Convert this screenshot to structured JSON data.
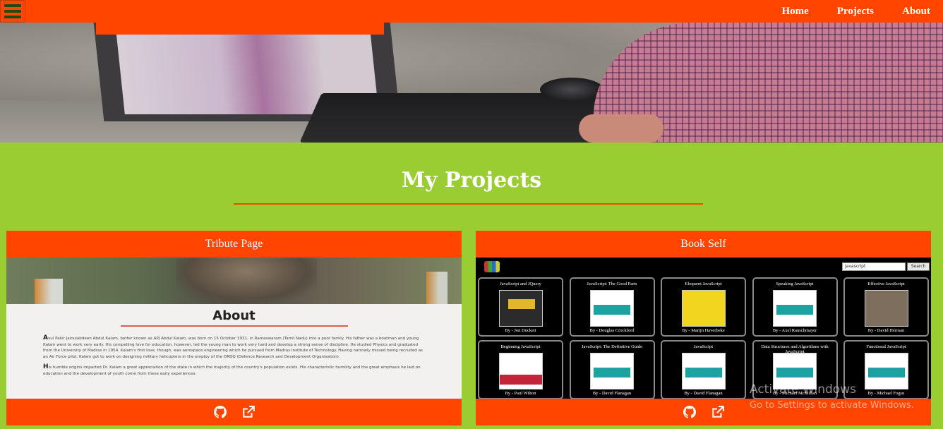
{
  "navbar": {
    "menu_icon": "hamburger-icon",
    "links": [
      "Home",
      "Projects",
      "About"
    ]
  },
  "section": {
    "title": "My Projects"
  },
  "projects": [
    {
      "title": "Tribute Page",
      "preview": {
        "heading": "About",
        "para1_cap": "A",
        "para1": "vul Pakir Jainulabdeen Abdul Kalam, better known as APJ Abdul Kalam, was born on 15 October 1931, in Rameswaram (Tamil Nadu) into a poor family. His father was a boatman and young Kalam went to work very early. His compelling love for education, however, led the young man to work very hard and develop a strong sense of discipline. He studied Physics and graduated from the University of Madras in 1954. Kalam's first love, though, was aerospace engineering which he pursued from Madras Institute of Technology. Having narrowly missed being recruited as an Air Force pilot, Kalam got to work on designing military helicopters in the employ of the DRDO (Defence Research and Development Organisation).",
        "para2_cap": "H",
        "para2": "is humble origins imparted Dr. Kalam a great appreciation of the state in which the majority of the country's population exists. His characteristic humility and the great emphasis he laid on education and the development of youth come from these early experiences."
      },
      "footer_icons": [
        "github-icon",
        "external-link-icon"
      ]
    },
    {
      "title": "Book Self",
      "preview": {
        "search_value": "javascript",
        "search_button": "Search",
        "books": [
          {
            "title": "JavaScript and JQuery",
            "author": "By - Jon Duckett",
            "cover": "dark"
          },
          {
            "title": "JavaScript: The Good Parts",
            "author": "By - Douglas Crockford",
            "cover": "teal"
          },
          {
            "title": "Eloquent JavaScript",
            "author": "By - Marijn Haverbeke",
            "cover": "yellow"
          },
          {
            "title": "Speaking JavaScript",
            "author": "By - Axel Rauschmayer",
            "cover": "teal"
          },
          {
            "title": "Effective JavaScript",
            "author": "By - David Herman",
            "cover": "gray"
          },
          {
            "title": "Beginning JavaScript",
            "author": "By - Paul Wilton",
            "cover": "red"
          },
          {
            "title": "JavaScript: The Definitive Guide",
            "author": "By - David Flanagan",
            "cover": "teal"
          },
          {
            "title": "JavaScript",
            "author": "By - David Flanagan",
            "cover": "teal"
          },
          {
            "title": "Data Structures and Algorithms with JavaScript",
            "author": "By - Michael McMillan",
            "cover": "teal"
          },
          {
            "title": "Functional JavaScript",
            "author": "By - Michael Fogus",
            "cover": "teal"
          }
        ]
      },
      "footer_icons": [
        "github-icon",
        "external-link-icon"
      ]
    }
  ],
  "watermark": {
    "line1": "Activate Windows",
    "line2": "Go to Settings to activate Windows."
  },
  "colors": {
    "accent": "#ff4500",
    "background": "#9acd32"
  }
}
